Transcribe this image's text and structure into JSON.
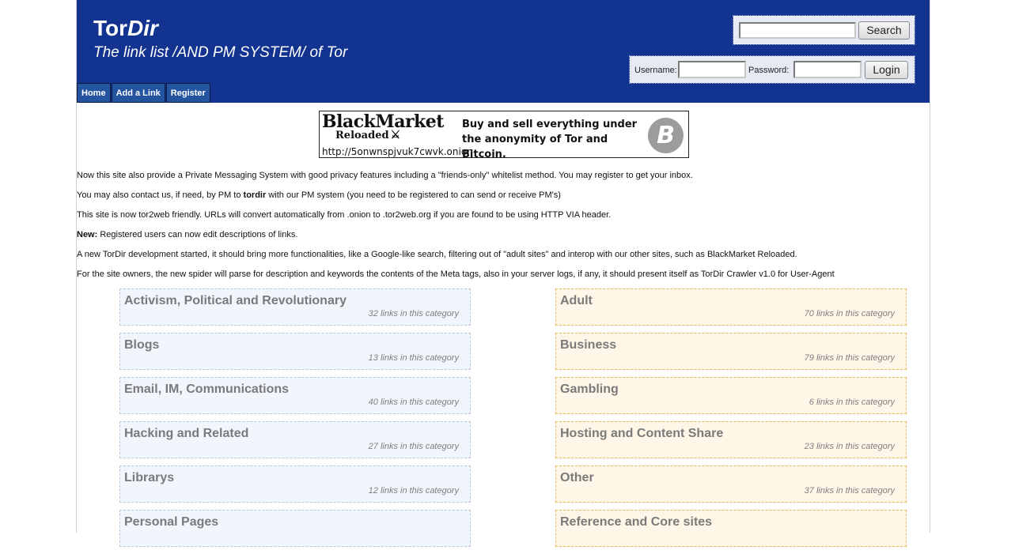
{
  "header": {
    "title_plain": "Tor",
    "title_italic": "Dir",
    "tagline": "The link list /AND PM SYSTEM/ of Tor",
    "colors": {
      "header_bg": "#12338f",
      "nav_bg": "#2454a0"
    }
  },
  "nav": {
    "items": [
      {
        "label": "Home"
      },
      {
        "label": "Add a Link"
      },
      {
        "label": "Register"
      }
    ]
  },
  "search": {
    "value": "",
    "placeholder": "",
    "button_label": "Search"
  },
  "login": {
    "username_label": "Username:",
    "username_value": "",
    "password_label": "Password:",
    "password_value": "",
    "button_label": "Login"
  },
  "banner": {
    "logo_top": "BlackMarket",
    "logo_sub": "Reloaded",
    "logo_mark": "⚔",
    "text": "Buy and sell everything under the anonymity of Tor and Bitcoin.",
    "url": "http://5onwnspjvuk7cwvk.onion",
    "icon": "bitcoin-icon",
    "icon_glyph": "B"
  },
  "notices": [
    {
      "prefix": "",
      "bold": "",
      "text": "Now this site also provide a Private Messaging System with good privacy features including a \"friends-only\" whitelist method. You may register to get your inbox.",
      "suffix": ""
    },
    {
      "prefix": "You may also contact us, if need, by PM to ",
      "bold": "tordir",
      "text": "",
      "suffix": " with our PM system (you need to be registered to can send or receive PM's)"
    },
    {
      "prefix": "",
      "bold": "",
      "text": "This site is now tor2web friendly. URLs will convert automatically from .onion to .tor2web.org if you are found to be using HTTP VIA header.",
      "suffix": ""
    },
    {
      "prefix": "",
      "bold": "New:",
      "text": "",
      "suffix": " Registered users can now edit descriptions of links."
    },
    {
      "prefix": "",
      "bold": "",
      "text": "A new TorDir development started, it should bring more functionalities, like a Google-like search, filtering out of \"adult sites\" and interop with our other sites, such as BlackMarket Reloaded.",
      "suffix": ""
    },
    {
      "prefix": "",
      "bold": "",
      "text": "For the site owners, the new spider will parse for description and keywords the contents of the Meta tags, also in your server logs, if any, it should present itself as TorDir Crawler v1.0 for User-Agent",
      "suffix": ""
    }
  ],
  "categories": {
    "left": [
      {
        "name": "Activism, Political and Revolutionary",
        "count": "32 links in this category"
      },
      {
        "name": "Blogs",
        "count": "13 links in this category"
      },
      {
        "name": "Email, IM, Communications",
        "count": "40 links in this category"
      },
      {
        "name": "Hacking and Related",
        "count": "27 links in this category"
      },
      {
        "name": "Librarys",
        "count": "12 links in this category"
      },
      {
        "name": "Personal Pages",
        "count": ""
      }
    ],
    "right": [
      {
        "name": "Adult",
        "count": "70 links in this category"
      },
      {
        "name": "Business",
        "count": "79 links in this category"
      },
      {
        "name": "Gambling",
        "count": "6 links in this category"
      },
      {
        "name": "Hosting and Content Share",
        "count": "23 links in this category"
      },
      {
        "name": "Other",
        "count": "37 links in this category"
      },
      {
        "name": "Reference and Core sites",
        "count": ""
      }
    ]
  }
}
